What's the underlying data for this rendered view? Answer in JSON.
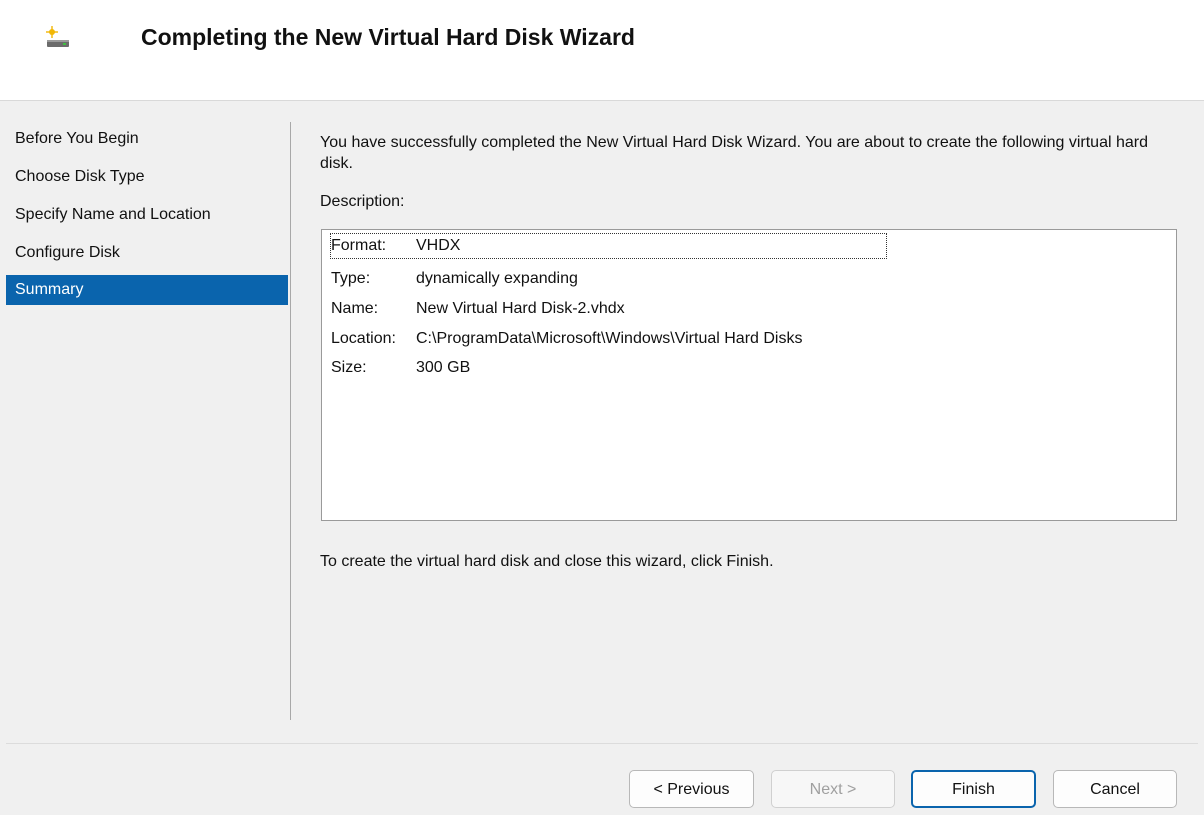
{
  "header": {
    "title": "Completing the New Virtual Hard Disk Wizard",
    "icon": "new-disk-icon"
  },
  "nav": {
    "items": [
      {
        "label": "Before You Begin"
      },
      {
        "label": "Choose Disk Type"
      },
      {
        "label": "Specify Name and Location"
      },
      {
        "label": "Configure Disk"
      },
      {
        "label": "Summary",
        "active": true
      }
    ]
  },
  "content": {
    "intro": "You have successfully completed the New Virtual Hard Disk Wizard. You are about to create the following virtual hard disk.",
    "description_label": "Description:",
    "summary": [
      {
        "key": "Format:",
        "value": "VHDX"
      },
      {
        "key": "Type:",
        "value": "dynamically expanding"
      },
      {
        "key": "Name:",
        "value": "New Virtual Hard Disk-2.vhdx"
      },
      {
        "key": "Location:",
        "value": "C:\\ProgramData\\Microsoft\\Windows\\Virtual Hard Disks"
      },
      {
        "key": "Size:",
        "value": "300 GB"
      }
    ],
    "outro": "To create the virtual hard disk and close this wizard, click Finish."
  },
  "buttons": {
    "previous": "< Previous",
    "next": "Next >",
    "finish": "Finish",
    "cancel": "Cancel"
  },
  "colors": {
    "selection": "#0a64ad",
    "background": "#f0f0f0"
  }
}
